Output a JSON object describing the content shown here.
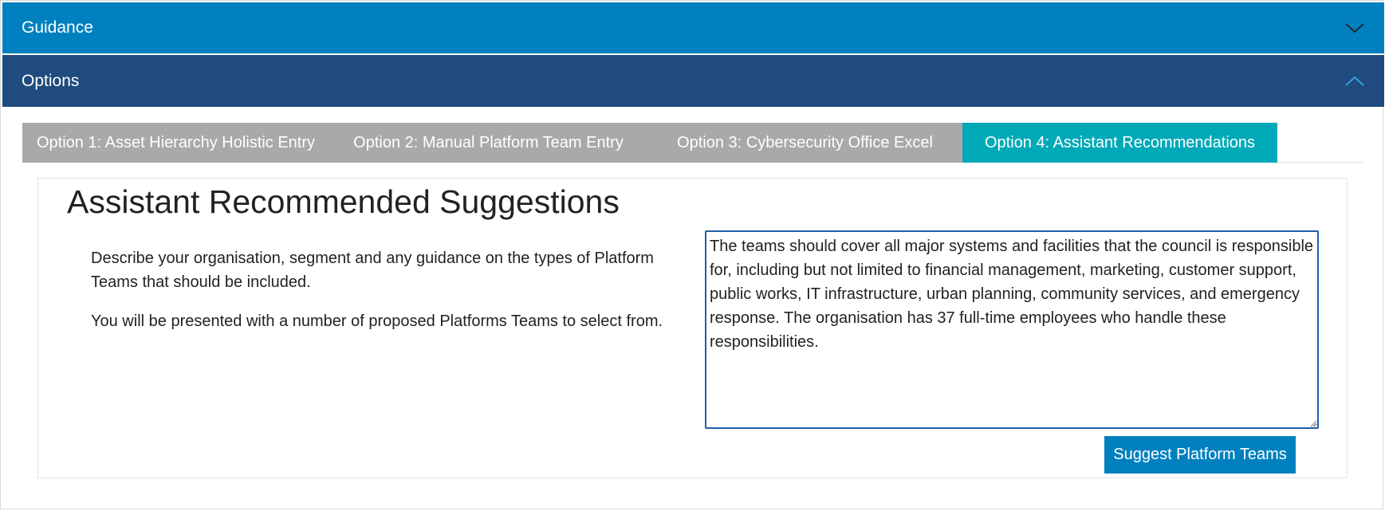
{
  "accordion": {
    "guidance": {
      "label": "Guidance",
      "icon": "chevron-down-icon",
      "background": "#0080be"
    },
    "options": {
      "label": "Options",
      "icon": "chevron-up-icon",
      "background": "#1f4b7e"
    }
  },
  "tabs": [
    {
      "label": "Option 1: Asset Hierarchy Holistic Entry",
      "active": false
    },
    {
      "label": "Option 2: Manual Platform Team Entry",
      "active": false
    },
    {
      "label": "Option 3: Cybersecurity Office Excel",
      "active": false
    },
    {
      "label": "Option 4: Assistant Recommendations",
      "active": true
    }
  ],
  "colors": {
    "tab_inactive": "#a9a9a9",
    "tab_active": "#00a9b8",
    "button": "#0080be",
    "textarea_border": "#1f5fa8"
  },
  "panel": {
    "title": "Assistant Recommended Suggestions",
    "description_1": "Describe your organisation, segment and any guidance on the types of Platform Teams that should be included.",
    "description_2": "You will be presented with a number of proposed Platforms Teams to select from.",
    "textarea_value": "The teams should cover all major systems and facilities that the council is responsible for, including but not limited to financial management, marketing, customer support, public works, IT infrastructure, urban planning, community services, and emergency response. The organisation has 37 full-time employees who handle these responsibilities.",
    "button_label": "Suggest Platform Teams"
  }
}
